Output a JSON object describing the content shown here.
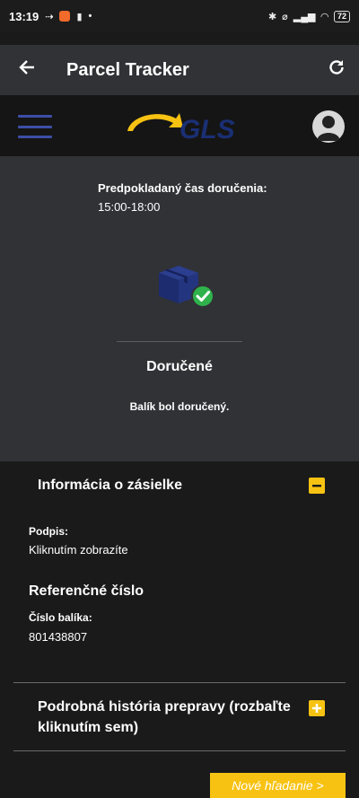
{
  "statusbar": {
    "time": "13:19",
    "battery": "72",
    "icons": [
      "cast-icon",
      "app-notification-icon",
      "sim-icon",
      "dot-icon",
      "bluetooth-icon",
      "alarm-off-icon",
      "signal-icon",
      "wifi-icon",
      "battery-icon"
    ]
  },
  "appbar": {
    "title": "Parcel Tracker",
    "back_icon": "arrow-left-icon",
    "refresh_icon": "refresh-icon"
  },
  "header": {
    "logo_text": "GLS",
    "brand_colors": {
      "blue": "#1a2f74",
      "yellow": "#f7c212"
    }
  },
  "delivery": {
    "eta_label": "Predpokladaný čas doručenia:",
    "eta_value": "15:00-18:00",
    "status_title": "Doručené",
    "status_desc": "Balík bol doručený."
  },
  "info": {
    "header": "Informácia o zásielke",
    "signature_label": "Podpis:",
    "signature_value": "Kliknutím zobrazíte",
    "reference_title": "Referenčné číslo",
    "parcel_number_label": "Číslo balíka:",
    "parcel_number_value": "801438807",
    "history_label": "Podrobná história prepravy (rozbaľte kliknutím sem)",
    "new_search_label": "Nové hľadanie >"
  },
  "colors": {
    "accent": "#f7c212",
    "success": "#2fb24c",
    "card": "#303236"
  }
}
